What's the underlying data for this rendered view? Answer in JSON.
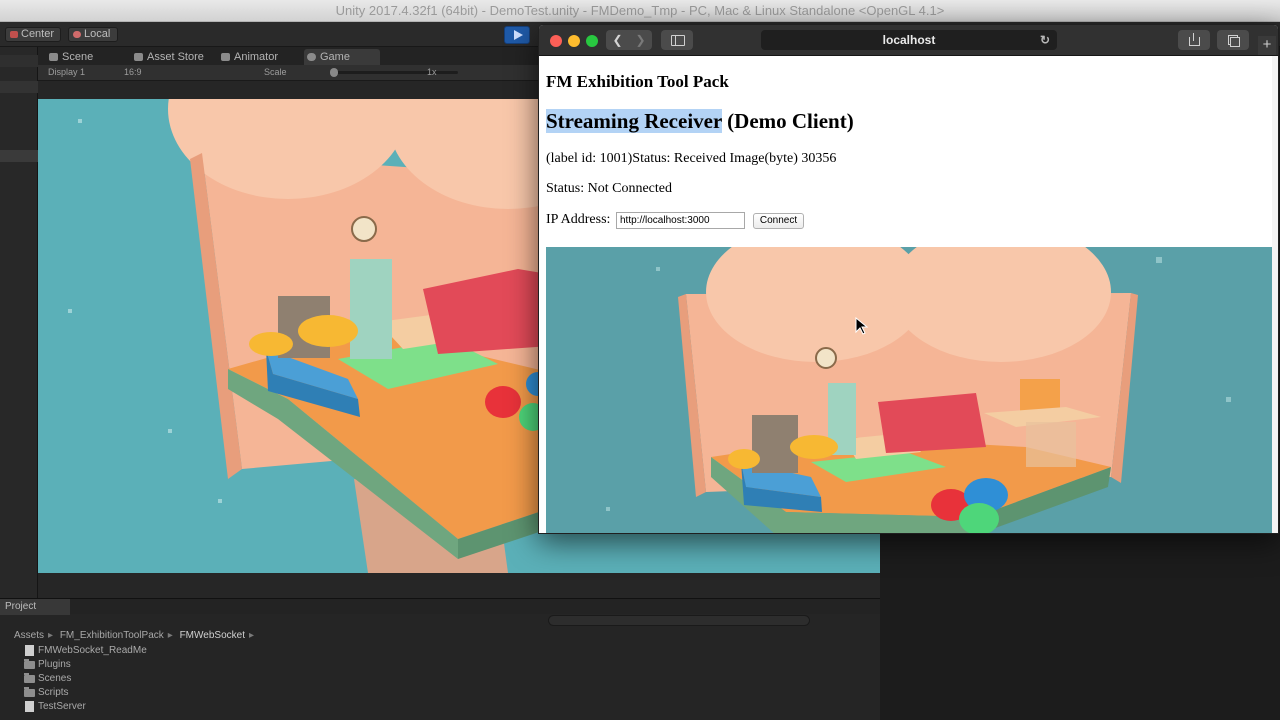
{
  "unity": {
    "window_title": "Unity 2017.4.32f1 (64bit) - DemoTest.unity - FMDemo_Tmp - PC, Mac & Linux Standalone <OpenGL 4.1>",
    "toolbar": {
      "pivot_label": "Center",
      "space_label": "Local"
    },
    "tabs": [
      {
        "label": "Scene",
        "icon": "scene-icon"
      },
      {
        "label": "Asset Store",
        "icon": "asset-store-icon"
      },
      {
        "label": "Animator",
        "icon": "animator-icon"
      },
      {
        "label": "Game",
        "icon": "game-icon"
      }
    ],
    "game_bar": {
      "display": "Display 1",
      "aspect": "16:9",
      "scale_label": "Scale",
      "scale_value": "1x"
    },
    "project": {
      "tab_label": "Project",
      "breadcrumb": [
        "Assets",
        "FM_ExhibitionToolPack",
        "FMWebSocket"
      ],
      "items": [
        {
          "label": "FMWebSocket_ReadMe",
          "type": "file"
        },
        {
          "label": "Plugins",
          "type": "folder"
        },
        {
          "label": "Scenes",
          "type": "folder"
        },
        {
          "label": "Scripts",
          "type": "folder"
        },
        {
          "label": "TestServer",
          "type": "file"
        }
      ]
    }
  },
  "browser": {
    "address": "localhost",
    "page": {
      "heading_small": "FM Exhibition Tool Pack",
      "heading_selected": "Streaming Receiver",
      "heading_rest": " (Demo Client)",
      "status_line_1": "(label id: 1001)Status: Received Image(byte) 30356",
      "status_line_2": "Status: Not Connected",
      "ip_label": "IP Address:",
      "ip_value": "http://localhost:3000",
      "connect_label": "Connect"
    }
  },
  "colors": {
    "unity_bg": "#1e1e1e",
    "game_sky": "#5bb0b8",
    "play_blue": "#1f5aa8",
    "selection": "#b3d3f5"
  }
}
